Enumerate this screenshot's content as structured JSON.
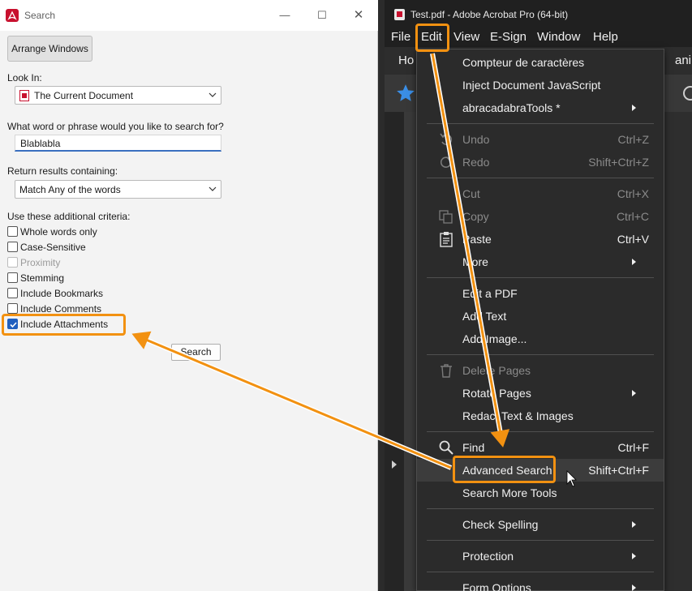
{
  "search_window": {
    "title": "Search",
    "arrange_button": "Arrange Windows",
    "look_in_label": "Look In:",
    "look_in_value": "The Current Document",
    "query_label": "What word or phrase would you like to search for?",
    "query_value": "Blablabla",
    "results_label": "Return results containing:",
    "results_value": "Match Any of the words",
    "criteria_label": "Use these additional criteria:",
    "criteria": [
      {
        "label": "Whole words only",
        "checked": false,
        "enabled": true
      },
      {
        "label": "Case-Sensitive",
        "checked": false,
        "enabled": true
      },
      {
        "label": "Proximity",
        "checked": false,
        "enabled": false
      },
      {
        "label": "Stemming",
        "checked": false,
        "enabled": true
      },
      {
        "label": "Include Bookmarks",
        "checked": false,
        "enabled": true
      },
      {
        "label": "Include Comments",
        "checked": false,
        "enabled": true
      },
      {
        "label": "Include Attachments",
        "checked": true,
        "enabled": true
      }
    ],
    "search_button": "Search"
  },
  "acrobat": {
    "title": "Test.pdf - Adobe Acrobat Pro (64-bit)",
    "menus": [
      "File",
      "Edit",
      "View",
      "E-Sign",
      "Window",
      "Help"
    ],
    "tab_left": "Ho",
    "tab_right": "ani",
    "edit_menu": {
      "items": [
        {
          "label": "Compteur de caractères",
          "shortcut": "",
          "submenu": false,
          "disabled": false,
          "icon": ""
        },
        {
          "label": "Inject Document JavaScript",
          "shortcut": "",
          "submenu": false,
          "disabled": false,
          "icon": ""
        },
        {
          "label": "abracadabraTools *",
          "shortcut": "",
          "submenu": true,
          "disabled": false,
          "icon": ""
        },
        {
          "label": "Undo",
          "shortcut": "Ctrl+Z",
          "submenu": false,
          "disabled": true,
          "icon": "undo-icon"
        },
        {
          "label": "Redo",
          "shortcut": "Shift+Ctrl+Z",
          "submenu": false,
          "disabled": true,
          "icon": "redo-icon"
        },
        {
          "label": "Cut",
          "shortcut": "Ctrl+X",
          "submenu": false,
          "disabled": true,
          "icon": ""
        },
        {
          "label": "Copy",
          "shortcut": "Ctrl+C",
          "submenu": false,
          "disabled": true,
          "icon": "copy-icon"
        },
        {
          "label": "Paste",
          "shortcut": "Ctrl+V",
          "submenu": false,
          "disabled": false,
          "icon": "paste-icon"
        },
        {
          "label": "More",
          "shortcut": "",
          "submenu": true,
          "disabled": false,
          "icon": ""
        },
        {
          "label": "Edit a PDF",
          "shortcut": "",
          "submenu": false,
          "disabled": false,
          "icon": ""
        },
        {
          "label": "Add Text",
          "shortcut": "",
          "submenu": false,
          "disabled": false,
          "icon": ""
        },
        {
          "label": "Add Image...",
          "shortcut": "",
          "submenu": false,
          "disabled": false,
          "icon": ""
        },
        {
          "label": "Delete Pages",
          "shortcut": "",
          "submenu": false,
          "disabled": true,
          "icon": "trash-icon"
        },
        {
          "label": "Rotate Pages",
          "shortcut": "",
          "submenu": true,
          "disabled": false,
          "icon": ""
        },
        {
          "label": "Redact Text & Images",
          "shortcut": "",
          "submenu": false,
          "disabled": false,
          "icon": ""
        },
        {
          "label": "Find",
          "shortcut": "Ctrl+F",
          "submenu": false,
          "disabled": false,
          "icon": "search-icon"
        },
        {
          "label": "Advanced Search",
          "shortcut": "Shift+Ctrl+F",
          "submenu": false,
          "disabled": false,
          "icon": ""
        },
        {
          "label": "Search More Tools",
          "shortcut": "",
          "submenu": false,
          "disabled": false,
          "icon": ""
        },
        {
          "label": "Check Spelling",
          "shortcut": "",
          "submenu": true,
          "disabled": false,
          "icon": ""
        },
        {
          "label": "Protection",
          "shortcut": "",
          "submenu": true,
          "disabled": false,
          "icon": ""
        },
        {
          "label": "Form Options",
          "shortcut": "",
          "submenu": true,
          "disabled": false,
          "icon": ""
        }
      ]
    }
  },
  "colors": {
    "annotation": "#f29111",
    "checkbox_checked": "#1f5fbf",
    "menu_bg": "#2b2b2b",
    "acrobat_red": "#c8102e"
  }
}
